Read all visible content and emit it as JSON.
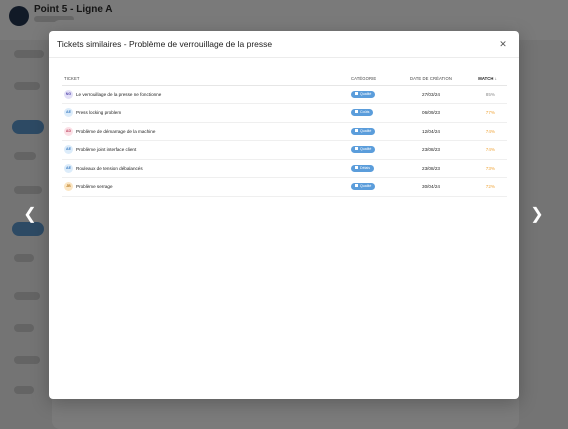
{
  "background": {
    "title": "Point 5 - Ligne A"
  },
  "modal": {
    "title": "Tickets similaires - Problème de verrouillage de la presse"
  },
  "table": {
    "headers": {
      "ticket": "TICKET",
      "category": "CATÉGORIE",
      "date": "DATE DE CRÉATION",
      "match": "MATCH ↓"
    },
    "rows": [
      {
        "initials": "NG",
        "avatar_bg": "#e3e0f7",
        "avatar_fg": "#5b4fb0",
        "ticket": "Le verrouillage de la presse ne fonctionne",
        "category": "Qualité",
        "category_color": "#5b9ddb",
        "date": "27/03/24",
        "match": "85%",
        "match_color": "#8a8a8a"
      },
      {
        "initials": "AE",
        "avatar_bg": "#dcecfa",
        "avatar_fg": "#3f7fc4",
        "ticket": "Press locking problem",
        "category": "Coûts",
        "category_color": "#5b9ddb",
        "date": "06/09/23",
        "match": "77%",
        "match_color": "#f0a63c"
      },
      {
        "initials": "AD",
        "avatar_bg": "#fbe0e6",
        "avatar_fg": "#c24a66",
        "ticket": "Problème de démarrage de la machine",
        "category": "Qualité",
        "category_color": "#5b9ddb",
        "date": "12/04/24",
        "match": "74%",
        "match_color": "#f0a63c"
      },
      {
        "initials": "AE",
        "avatar_bg": "#dcecfa",
        "avatar_fg": "#3f7fc4",
        "ticket": "Problème joint interface client",
        "category": "Qualité",
        "category_color": "#5b9ddb",
        "date": "23/08/23",
        "match": "74%",
        "match_color": "#f0a63c"
      },
      {
        "initials": "AE",
        "avatar_bg": "#dcecfa",
        "avatar_fg": "#3f7fc4",
        "ticket": "Rouleaux de tension débalancés",
        "category": "Délais",
        "category_color": "#5b9ddb",
        "date": "23/08/23",
        "match": "73%",
        "match_color": "#f0a63c"
      },
      {
        "initials": "JB",
        "avatar_bg": "#fbe6c4",
        "avatar_fg": "#b9791f",
        "ticket": "Problème serrage",
        "category": "Qualité",
        "category_color": "#5b9ddb",
        "date": "30/04/24",
        "match": "72%",
        "match_color": "#f0a63c"
      }
    ]
  },
  "icons": {
    "close": "close-icon",
    "prev": "chevron-left-icon",
    "next": "chevron-right-icon"
  }
}
